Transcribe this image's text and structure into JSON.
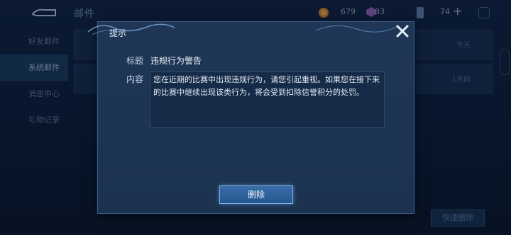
{
  "topbar": {
    "title": "邮件",
    "gold": "679",
    "gems": "83",
    "tickets": "74"
  },
  "sidebar": {
    "items": [
      {
        "label": "好友邮件"
      },
      {
        "label": "系统邮件"
      },
      {
        "label": "消息中心"
      },
      {
        "label": "礼物记录"
      }
    ]
  },
  "mail_list": {
    "rows": [
      {
        "time": "今天"
      },
      {
        "time": "1天前"
      }
    ]
  },
  "quick_delete_label": "快速删除",
  "dialog": {
    "title": "提示",
    "subject_label": "标题",
    "subject": "违规行为警告",
    "content_label": "内容",
    "content": "您在近期的比赛中出现违规行为，请您引起重视。如果您在接下来的比赛中继续出现该类行为，将会受到扣除信誉积分的处罚。",
    "delete_label": "删除"
  },
  "colors": {
    "accent": "#7fb0e0",
    "background": "#0b1b33",
    "dialog": "#1f3656"
  },
  "icons": [
    "back-arrow-icon",
    "gold-coin-icon",
    "gem-icon",
    "ticket-icon",
    "plus-icon",
    "close-icon"
  ]
}
